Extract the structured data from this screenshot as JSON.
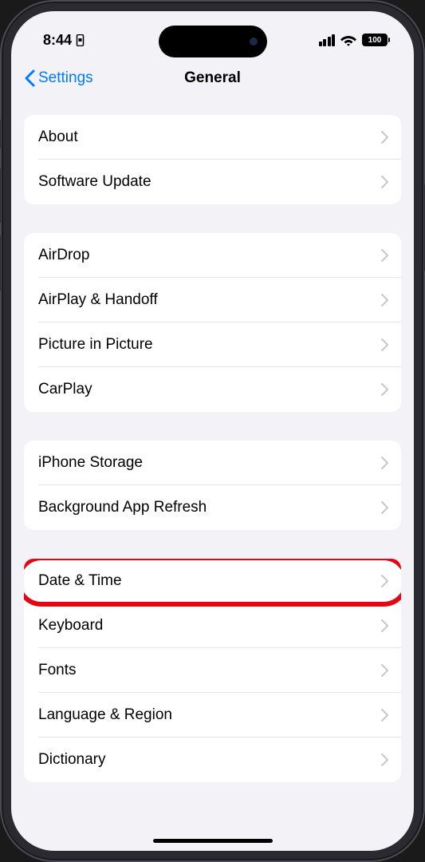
{
  "status": {
    "time": "8:44",
    "battery_pct": "100"
  },
  "nav": {
    "back_label": "Settings",
    "title": "General"
  },
  "groups": [
    {
      "rows": [
        {
          "id": "about",
          "label": "About"
        },
        {
          "id": "software-update",
          "label": "Software Update"
        }
      ]
    },
    {
      "rows": [
        {
          "id": "airdrop",
          "label": "AirDrop"
        },
        {
          "id": "airplay-handoff",
          "label": "AirPlay & Handoff"
        },
        {
          "id": "picture-in-picture",
          "label": "Picture in Picture"
        },
        {
          "id": "carplay",
          "label": "CarPlay"
        }
      ]
    },
    {
      "rows": [
        {
          "id": "iphone-storage",
          "label": "iPhone Storage"
        },
        {
          "id": "background-app-refresh",
          "label": "Background App Refresh"
        }
      ]
    },
    {
      "rows": [
        {
          "id": "date-time",
          "label": "Date & Time",
          "highlighted": true
        },
        {
          "id": "keyboard",
          "label": "Keyboard"
        },
        {
          "id": "fonts",
          "label": "Fonts"
        },
        {
          "id": "language-region",
          "label": "Language & Region"
        },
        {
          "id": "dictionary",
          "label": "Dictionary"
        }
      ]
    }
  ]
}
